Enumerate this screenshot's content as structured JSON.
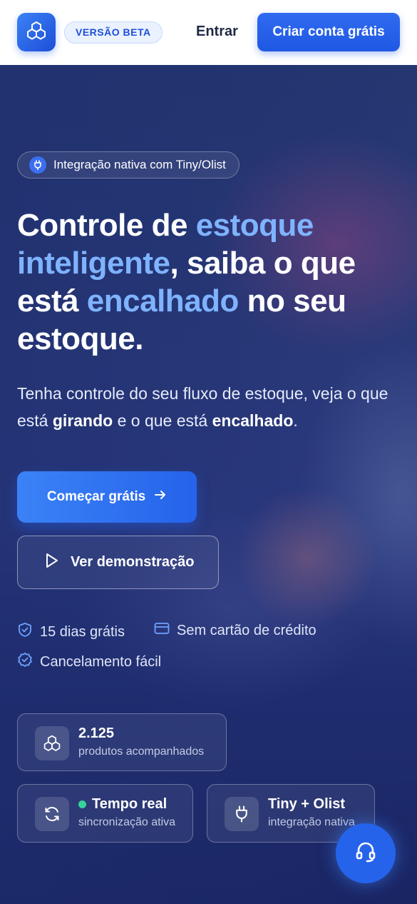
{
  "header": {
    "logo_icon": "cubes-icon",
    "beta_badge": "VERSÃO BETA",
    "login_label": "Entrar",
    "signup_label": "Criar conta grátis"
  },
  "hero": {
    "integration_pill": {
      "icon": "plug-icon",
      "text": "Integração nativa com Tiny/Olist"
    },
    "headline": {
      "part1": "Controle de ",
      "highlight1": "estoque inteligente",
      "part2": ", saiba o que está ",
      "highlight2": "encalhado",
      "part3": " no seu estoque."
    },
    "subtitle": {
      "part1": "Tenha controle do seu fluxo de estoque, veja o que está ",
      "bold1": "girando",
      "part2": " e o que está ",
      "bold2": "encalhado",
      "part3": "."
    },
    "cta_label": "Começar grátis",
    "demo_label": "Ver demonstração",
    "features": [
      {
        "icon": "shield-check-icon",
        "label": "15 dias grátis"
      },
      {
        "icon": "credit-card-icon",
        "label": "Sem cartão de crédito"
      },
      {
        "icon": "badge-check-icon",
        "label": "Cancelamento fácil"
      }
    ],
    "stats": [
      {
        "icon": "cubes-icon",
        "title": "2.125",
        "subtitle": "produtos acompanhados"
      },
      {
        "icon": "refresh-icon",
        "title": "Tempo real",
        "subtitle": "sincronização ativa",
        "status_color": "#34d399"
      },
      {
        "icon": "plug-icon",
        "title": "Tiny + Olist",
        "subtitle": "integração nativa"
      }
    ]
  },
  "support_button_icon": "headset-icon",
  "colors": {
    "accent": "#2563eb",
    "highlight": "#7fb3ff",
    "status_live": "#34d399"
  }
}
